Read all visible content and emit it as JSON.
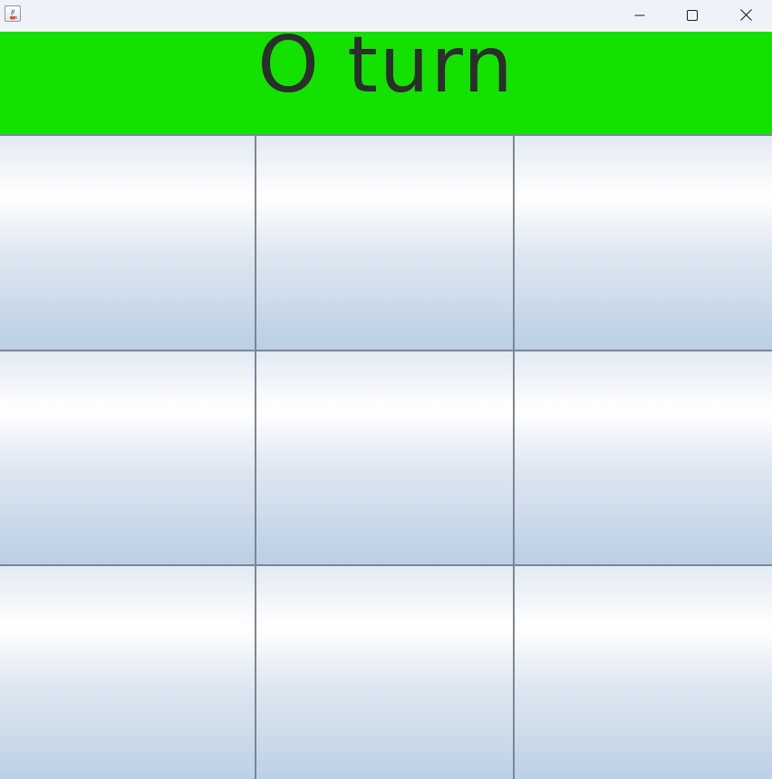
{
  "window": {
    "title": "",
    "icon": "java-app-icon",
    "controls": [
      "minimize-icon",
      "maximize-icon",
      "close-icon"
    ]
  },
  "banner": {
    "text": "O turn",
    "background": "#13e100",
    "text_color": "#2b2e2d"
  },
  "board": {
    "rows": 3,
    "cols": 3,
    "cells": [
      [
        "",
        "",
        ""
      ],
      [
        "",
        "",
        ""
      ],
      [
        "",
        "",
        ""
      ]
    ]
  }
}
